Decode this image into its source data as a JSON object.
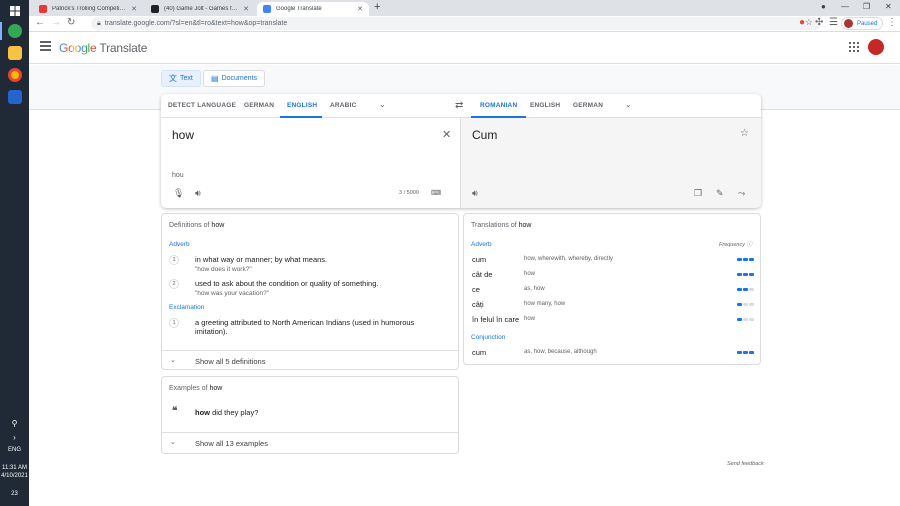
{
  "taskbar": {
    "language": "ENG",
    "time": "11:31 AM",
    "date": "4/10/2021",
    "notification_count": "23"
  },
  "browser": {
    "tabs": [
      {
        "title": "Patrick's Trolling Competition - ...",
        "favicon_color": "#e53935"
      },
      {
        "title": "(40) Game Jolt - Games for the lo...",
        "favicon_color": "#202124"
      },
      {
        "title": "Google Translate",
        "favicon_color": "#4285f4"
      }
    ],
    "new_tab": "+",
    "url": "translate.google.com/?sl=en&tl=ro&text=how&op=translate",
    "profile_status": "Paused"
  },
  "header": {
    "logo_word": "Google",
    "product": "Translate"
  },
  "modes": {
    "text": "Text",
    "documents": "Documents"
  },
  "source_languages": [
    "DETECT LANGUAGE",
    "GERMAN",
    "ENGLISH",
    "ARABIC"
  ],
  "target_languages": [
    "ROMANIAN",
    "ENGLISH",
    "GERMAN"
  ],
  "source": {
    "text": "how",
    "transliteration": "hou",
    "char_count": "3 / 5000"
  },
  "target": {
    "text": "Cum"
  },
  "definitions": {
    "title_prefix": "Definitions of",
    "word": "how",
    "groups": [
      {
        "pos": "Adverb",
        "entries": [
          {
            "n": "1",
            "def": "in what way or manner; by what means.",
            "example": "\"how does it work?\""
          },
          {
            "n": "2",
            "def": "used to ask about the condition or quality of something.",
            "example": "\"how was your vacation?\""
          }
        ]
      },
      {
        "pos": "Exclamation",
        "entries": [
          {
            "n": "1",
            "def": "a greeting attributed to North American Indians (used in humorous imitation).",
            "example": ""
          }
        ]
      }
    ],
    "show_all": "Show all 5 definitions"
  },
  "examples": {
    "title_prefix": "Examples of",
    "word": "how",
    "example_bold": "how",
    "example_rest": " did they play?",
    "show_all": "Show all 13 examples"
  },
  "translations": {
    "title_prefix": "Translations of",
    "word": "how",
    "frequency_label": "Frequency",
    "groups": [
      {
        "pos": "Adverb",
        "rows": [
          {
            "word": "cum",
            "back": "how, wherewith, whereby, directly",
            "freq": 3
          },
          {
            "word": "cât de",
            "back": "how",
            "freq": 3
          },
          {
            "word": "ce",
            "back": "as, how",
            "freq": 2
          },
          {
            "word": "câți",
            "back": "how many, how",
            "freq": 1
          },
          {
            "word": "în felul în care",
            "back": "how",
            "freq": 1
          }
        ]
      },
      {
        "pos": "Conjunction",
        "rows": [
          {
            "word": "cum",
            "back": "as, how, because, although",
            "freq": 3
          }
        ]
      }
    ]
  },
  "feedback": "Send feedback"
}
